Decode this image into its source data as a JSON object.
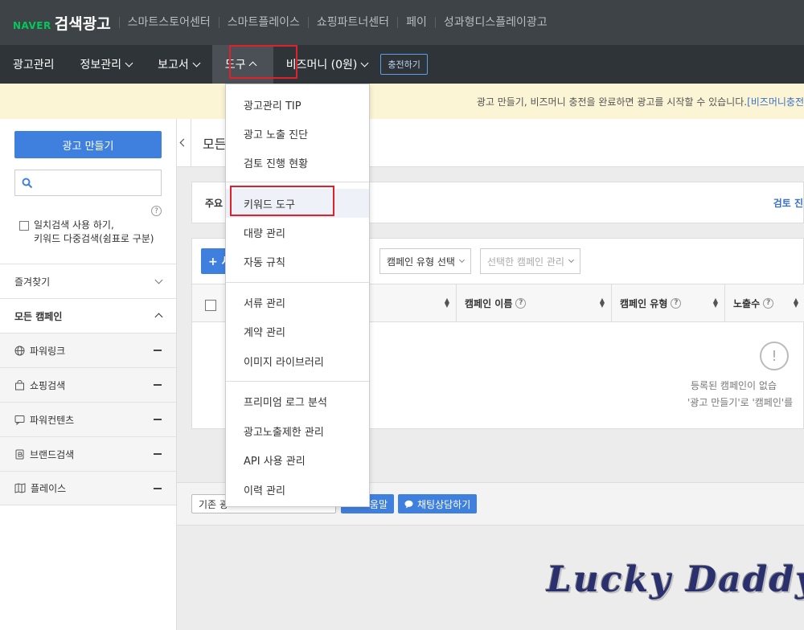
{
  "header": {
    "brand_naver": "NAVER",
    "brand_title": "검색광고",
    "links": [
      "스마트스토어센터",
      "스마트플레이스",
      "쇼핑파트너센터",
      "페이",
      "성과형디스플레이광고"
    ]
  },
  "menu": {
    "items": [
      "광고관리",
      "정보관리",
      "보고서",
      "도구",
      "비즈머니 (0원)"
    ],
    "charge_label": "충전하기"
  },
  "notice": {
    "text": "광고 만들기, 비즈머니 충전을 완료하면 광고를 시작할 수 있습니다.",
    "link": "[비즈머니충전"
  },
  "sidebar": {
    "create_label": "광고 만들기",
    "exact_line1": "일치검색 사용 하기,",
    "exact_line2": "키워드 다중검색(쉼표로 구분)",
    "favorites": "즐겨찾기",
    "all_campaigns": "모든 캠페인",
    "campaign_types": [
      "파워링크",
      "쇼핑검색",
      "파워컨텐츠",
      "브랜드검색",
      "플레이스"
    ]
  },
  "main": {
    "title": "모든",
    "card_label": "주요",
    "review_label": "검토 진",
    "add_label": "+ 새",
    "campaign_type_select": "캠페인 유형 선택",
    "selected_manage": "선택한 캠페인 관리",
    "columns": [
      "캠페인 이름",
      "캠페인 유형",
      "노출수"
    ],
    "empty_line1": "등록된 캠페인이 없습",
    "empty_line2": "'광고 만들기'로 '캠페인'를 ",
    "footer_left": "기존 광",
    "footer_help": "움말",
    "footer_chat": "채팅상담하기"
  },
  "dropdown": {
    "group1": [
      "광고관리 TIP",
      "광고 노출 진단",
      "검토 진행 현황"
    ],
    "group2": [
      "키워드 도구",
      "대량 관리",
      "자동 규칙"
    ],
    "group3": [
      "서류 관리",
      "계약 관리",
      "이미지 라이브러리"
    ],
    "group4": [
      "프리미엄 로그 분석",
      "광고노출제한 관리",
      "API 사용 관리",
      "이력 관리"
    ]
  },
  "watermark": "Lucky Daddy",
  "colors": {
    "accent": "#3f80df",
    "highlight": "#e0212b",
    "brand_green": "#03c75a"
  }
}
